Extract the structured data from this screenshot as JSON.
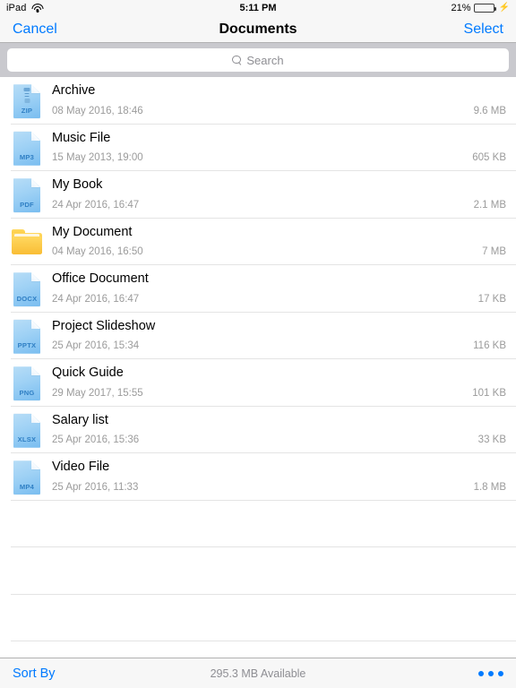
{
  "status_bar": {
    "carrier": "iPad",
    "wifi_icon": "wifi-icon",
    "time": "5:11 PM",
    "battery_percent": "21%",
    "battery_level": 21,
    "charging_icon": "lightning-bolt-icon"
  },
  "nav_bar": {
    "cancel_label": "Cancel",
    "title": "Documents",
    "select_label": "Select"
  },
  "search": {
    "placeholder": "Search",
    "value": "",
    "icon": "search-icon"
  },
  "list": {
    "empty_row_count": 4,
    "items": [
      {
        "name": "Archive",
        "date": "08 May 2016, 18:46",
        "size": "9.6 MB",
        "kind": "file",
        "type": "ZIP"
      },
      {
        "name": "Music File",
        "date": "15 May 2013, 19:00",
        "size": "605 KB",
        "kind": "file",
        "type": "MP3"
      },
      {
        "name": "My Book",
        "date": "24 Apr 2016, 16:47",
        "size": "2.1 MB",
        "kind": "file",
        "type": "PDF"
      },
      {
        "name": "My Document",
        "date": "04 May 2016, 16:50",
        "size": "7 MB",
        "kind": "folder",
        "type": ""
      },
      {
        "name": "Office Document",
        "date": "24 Apr 2016, 16:47",
        "size": "17 KB",
        "kind": "file",
        "type": "DOCX"
      },
      {
        "name": "Project Slideshow",
        "date": "25 Apr 2016, 15:34",
        "size": "116 KB",
        "kind": "file",
        "type": "PPTX"
      },
      {
        "name": "Quick Guide",
        "date": "29 May 2017, 15:55",
        "size": "101 KB",
        "kind": "file",
        "type": "PNG"
      },
      {
        "name": "Salary list",
        "date": "25 Apr 2016, 15:36",
        "size": "33 KB",
        "kind": "file",
        "type": "XLSX"
      },
      {
        "name": "Video File",
        "date": "25 Apr 2016, 11:33",
        "size": "1.8 MB",
        "kind": "file",
        "type": "MP4"
      }
    ]
  },
  "toolbar": {
    "sort_label": "Sort By",
    "storage_text": "295.3 MB Available",
    "more_icon": "more-dots-icon"
  },
  "colors": {
    "accent": "#007aff",
    "battery_green": "#4cd964",
    "chrome": "#f7f7f7",
    "search_background": "#c9c9ce",
    "secondary_text": "#9b9b9b",
    "separator": "#e4e4e4",
    "folder_yellow": "#fdc93f",
    "file_blue": "#9ed1f5",
    "file_label_blue": "#2f7fc4"
  }
}
